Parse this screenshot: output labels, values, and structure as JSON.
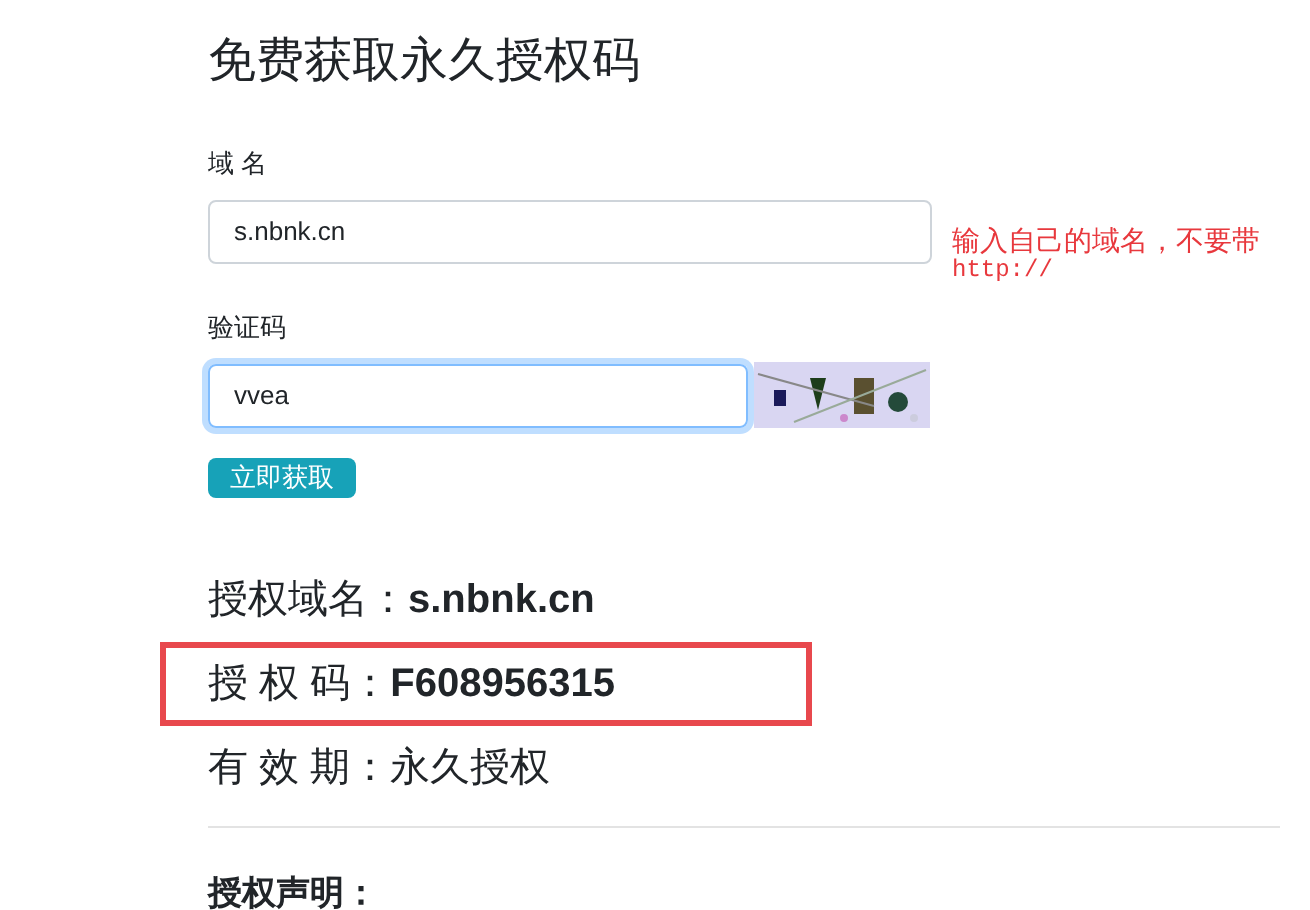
{
  "title": "免费获取永久授权码",
  "form": {
    "domain": {
      "label": "域 名",
      "value": "s.nbnk.cn",
      "hint": "输入自己的域名，不要带",
      "hint_code": "http://"
    },
    "captcha": {
      "label": "验证码",
      "value": "vvea",
      "focused": true
    },
    "submit": "立即获取"
  },
  "results": [
    {
      "label": "授权域名：",
      "value": "s.nbnk.cn",
      "bold": true,
      "highlighted": false
    },
    {
      "label": "授 权 码：",
      "value": "F608956315",
      "bold": true,
      "highlighted": true
    },
    {
      "label": "有 效 期：",
      "value": "永久授权",
      "bold": false,
      "highlighted": false
    }
  ],
  "statement_heading": "授权声明："
}
